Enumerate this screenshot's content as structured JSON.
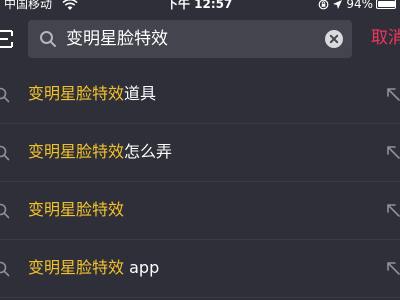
{
  "status_bar": {
    "carrier": "中国移动",
    "time": "下午 12:57",
    "battery": "94%"
  },
  "search": {
    "query": "变明星脸特效",
    "cancel_label": "取消"
  },
  "suggestions": [
    {
      "highlight": "变明星脸特效",
      "rest": "道具"
    },
    {
      "highlight": "变明星脸特效",
      "rest": "怎么弄"
    },
    {
      "highlight": "变明星脸特效",
      "rest": ""
    },
    {
      "highlight": "变明星脸特效",
      "rest": " app"
    }
  ],
  "colors": {
    "background": "#2e2f38",
    "search_box": "#43444e",
    "highlight": "#f2c22b",
    "cancel": "#f0375a"
  },
  "icons": [
    "wifi-icon",
    "rotation-lock-icon",
    "location-icon",
    "battery-icon",
    "back-icon",
    "search-icon",
    "clear-icon",
    "fill-arrow-icon"
  ]
}
